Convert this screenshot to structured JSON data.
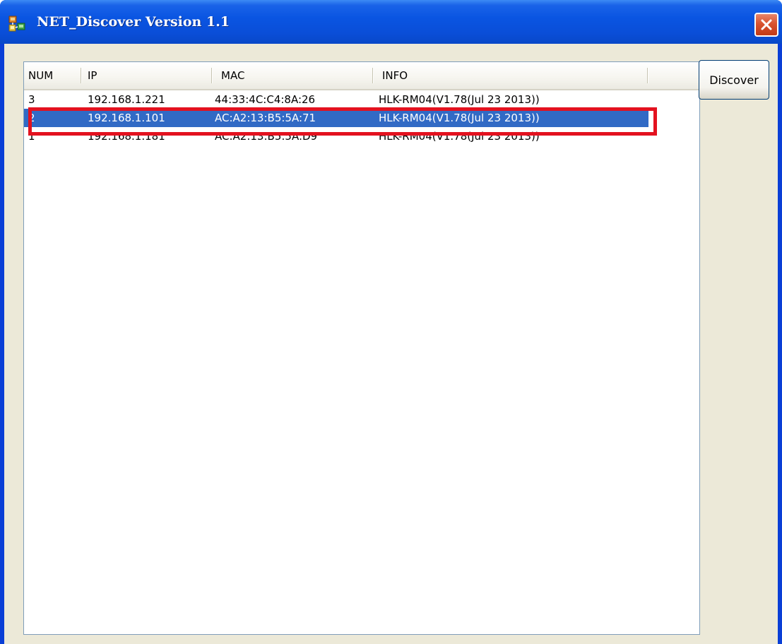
{
  "window": {
    "title": "NET_Discover Version 1.1"
  },
  "toolbar": {
    "discover_label": "Discover"
  },
  "table": {
    "columns": [
      "NUM",
      "IP",
      "MAC",
      "INFO"
    ],
    "rows": [
      {
        "num": "3",
        "ip": "192.168.1.221",
        "mac": "44:33:4C:C4:8A:26",
        "info": "HLK-RM04(V1.78(Jul 23 2013))"
      },
      {
        "num": "2",
        "ip": "192.168.1.101",
        "mac": "AC:A2:13:B5:5A:71",
        "info": "HLK-RM04(V1.78(Jul 23 2013))"
      },
      {
        "num": "1",
        "ip": "192.168.1.181",
        "mac": "AC:A2:13:B5:5A:D9",
        "info": "HLK-RM04(V1.78(Jul 23 2013))"
      }
    ],
    "selected_row": 1
  },
  "icons": {
    "app": "network-app-icon",
    "close": "close-icon"
  },
  "colors": {
    "titlebar": "#0a55e2",
    "selection": "#316ac5",
    "highlight_box": "#e3121f",
    "close_button": "#d9532f",
    "client_bg": "#ece9d8"
  }
}
